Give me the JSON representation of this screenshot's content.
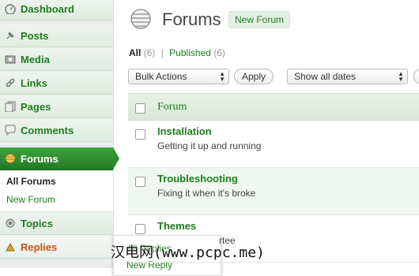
{
  "sidebar": {
    "items": [
      {
        "label": "Dashboard",
        "icon": "dashboard-icon"
      },
      {
        "label": "Posts",
        "icon": "pin-icon"
      },
      {
        "label": "Media",
        "icon": "media-icon"
      },
      {
        "label": "Links",
        "icon": "link-icon"
      },
      {
        "label": "Pages",
        "icon": "pages-icon"
      },
      {
        "label": "Comments",
        "icon": "comment-icon"
      },
      {
        "label": "Forums",
        "icon": "forum-icon"
      },
      {
        "label": "Topics",
        "icon": "topics-icon"
      },
      {
        "label": "Replies",
        "icon": "replies-icon"
      }
    ],
    "forums_submenu": [
      "All Forums",
      "New Forum"
    ],
    "replies_flyout": [
      "All Replies",
      "New Reply"
    ]
  },
  "page": {
    "title": "Forums",
    "new_button": "New Forum"
  },
  "views": {
    "all_label": "All",
    "all_count": "(6)",
    "separator": "|",
    "published_label": "Published",
    "published_count": "(6)"
  },
  "toolbar": {
    "bulk_actions": "Bulk Actions",
    "apply": "Apply",
    "dates": "Show all dates"
  },
  "table": {
    "column": "Forum",
    "rows": [
      {
        "title": "Installation",
        "description": "Getting it up and running"
      },
      {
        "title": "Troubleshooting",
        "description": "Fixing it when it's broke"
      },
      {
        "title": "Themes",
        "description": "rtee"
      }
    ]
  },
  "watermark": "汉电网(www.pcpc.me)",
  "colors": {
    "accent": "#1e7d1e",
    "active_menu": "#2d8c2d"
  }
}
